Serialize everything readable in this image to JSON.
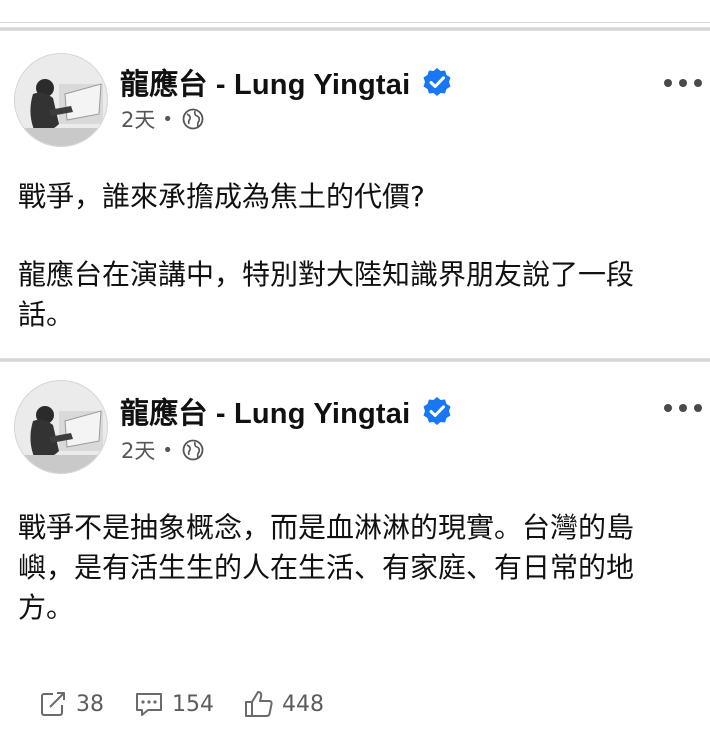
{
  "posts": [
    {
      "author": "龍應台 - Lung Yingtai",
      "time": "2天",
      "separator": "•",
      "paragraphs": [
        "戰爭，誰來承擔成為焦土的代價?",
        "龍應台在演講中，特別對大陸知識界朋友說了一段話。"
      ],
      "icons": {
        "verified": "verified-badge-icon",
        "privacy": "globe-icon",
        "more": "more-options-icon"
      }
    },
    {
      "author": "龍應台 - Lung Yingtai",
      "time": "2天",
      "separator": "•",
      "paragraphs": [
        "戰爭不是抽象概念，而是血淋淋的現實。台灣的島嶼，是有活生生的人在生活、有家庭、有日常的地方。"
      ],
      "icons": {
        "verified": "verified-badge-icon",
        "privacy": "globe-icon",
        "more": "more-options-icon"
      }
    }
  ],
  "actions": {
    "share_count": "38",
    "comment_count": "154",
    "like_count": "448"
  },
  "colors": {
    "verified_blue": "#1877f2",
    "text": "#111111",
    "muted": "#555555"
  }
}
